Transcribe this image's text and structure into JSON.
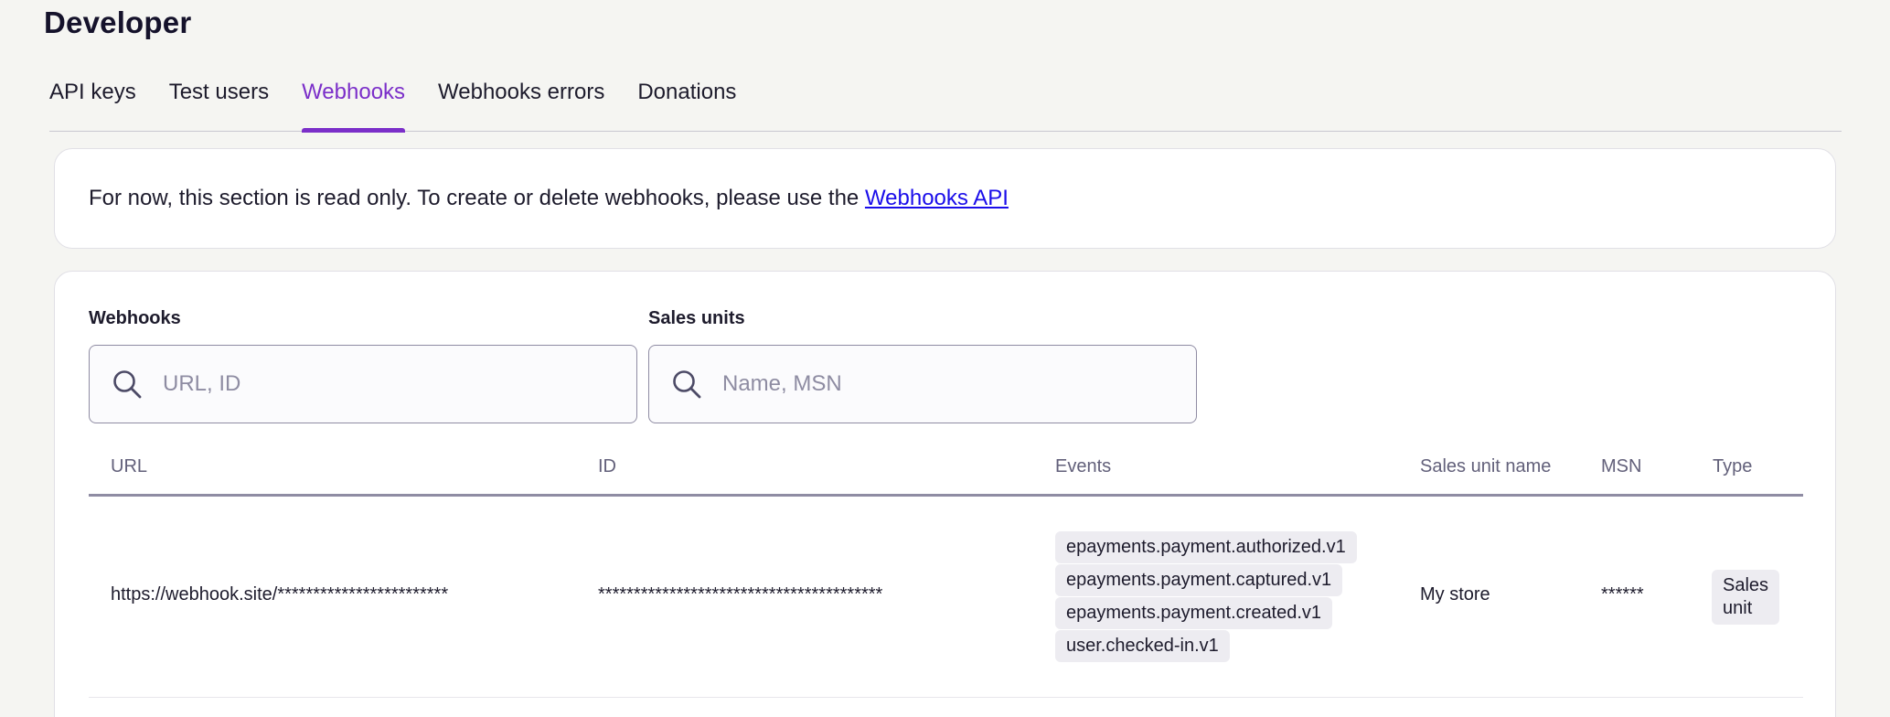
{
  "page": {
    "title": "Developer"
  },
  "tabs": [
    {
      "label": "API keys",
      "active": false
    },
    {
      "label": "Test users",
      "active": false
    },
    {
      "label": "Webhooks",
      "active": true
    },
    {
      "label": "Webhooks errors",
      "active": false
    },
    {
      "label": "Donations",
      "active": false
    }
  ],
  "notice": {
    "text": "For now, this section is read only. To create or delete webhooks, please use the ",
    "link_label": "Webhooks API"
  },
  "filters": {
    "webhooks": {
      "label": "Webhooks",
      "placeholder": "URL, ID",
      "value": ""
    },
    "sales_units": {
      "label": "Sales units",
      "placeholder": "Name, MSN",
      "value": ""
    }
  },
  "table": {
    "columns": [
      "URL",
      "ID",
      "Events",
      "Sales unit name",
      "MSN",
      "Type"
    ],
    "rows": [
      {
        "url": "https://webhook.site/************************",
        "id": "****************************************",
        "events": [
          "epayments.payment.authorized.v1",
          "epayments.payment.captured.v1",
          "epayments.payment.created.v1",
          "user.checked-in.v1"
        ],
        "sales_unit_name": "My store",
        "msn": "******",
        "type": "Sales unit"
      }
    ]
  },
  "colors": {
    "accent": "#7b2fc9",
    "link": "#1a0dea",
    "background": "#f5f5f2",
    "chip": "#edecf1"
  },
  "icons": {
    "search": "search-icon"
  }
}
